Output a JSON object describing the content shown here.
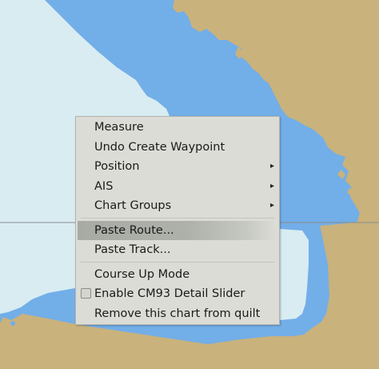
{
  "context_menu": {
    "items": [
      {
        "label": "Measure"
      },
      {
        "label": "Undo Create Waypoint"
      },
      {
        "label": "Position",
        "submenu_arrow": "▸"
      },
      {
        "label": "AIS",
        "submenu_arrow": "▸"
      },
      {
        "label": "Chart Groups",
        "submenu_arrow": "▸"
      },
      {
        "label": "Paste Route...",
        "highlighted": true
      },
      {
        "label": "Paste Track..."
      },
      {
        "label": "Course Up Mode"
      },
      {
        "label": "Enable CM93 Detail Slider",
        "checked": false
      },
      {
        "label": "Remove this chart from quilt"
      }
    ]
  },
  "chart": {
    "colors": {
      "land": "#c9b27c",
      "shallow_water": "#72aee8",
      "deep_water": "#d8ecf2",
      "menu_bg": "#dcdcd6",
      "highlight": "#aeb1aa"
    }
  }
}
